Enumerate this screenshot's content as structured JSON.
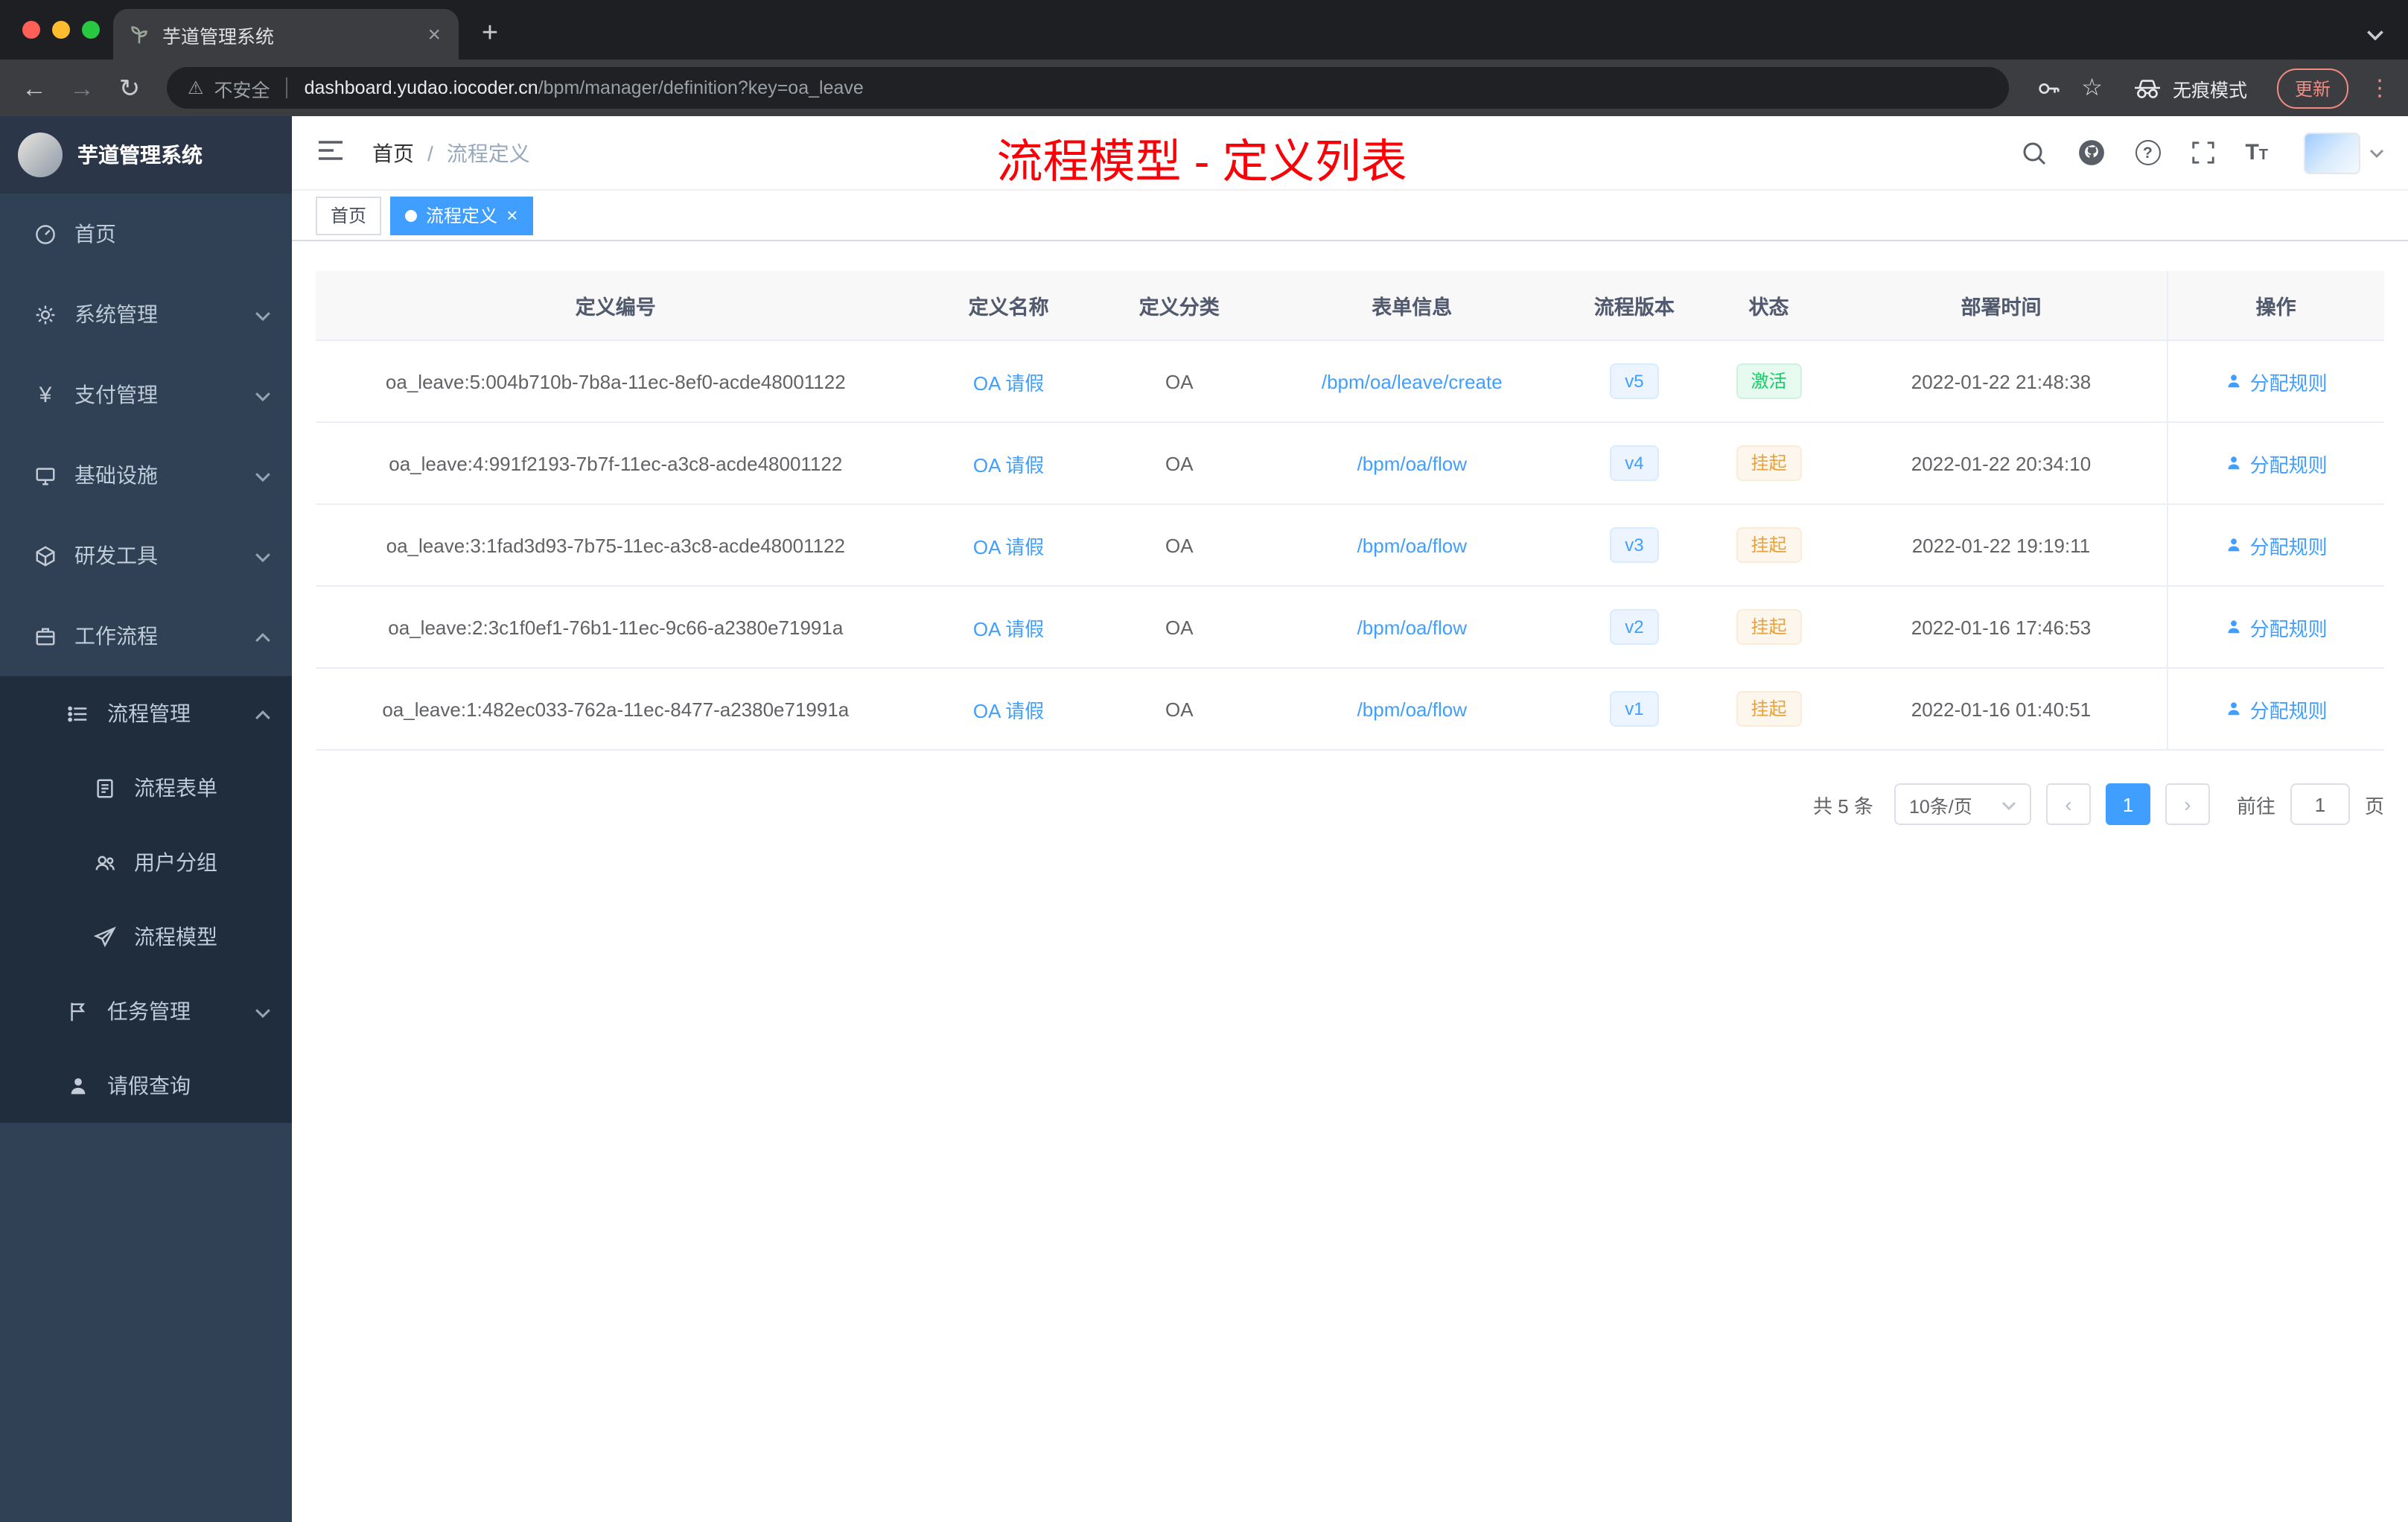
{
  "glyphs": {
    "back": "←",
    "forward": "→",
    "reload": "↻",
    "warning": "⚠",
    "star": "☆",
    "more": "⋮",
    "close": "×",
    "plus": "+",
    "question": "?",
    "font_big": "T",
    "font_small": "T",
    "yen": "¥",
    "prev": "‹",
    "next": "›"
  },
  "browser": {
    "tab_title": "芋道管理系统",
    "security_label": "不安全",
    "url_domain": "dashboard.yudao.iocoder.cn",
    "url_path": "/bpm/manager/definition?key=oa_leave",
    "incognito_label": "无痕模式",
    "update_label": "更新"
  },
  "sidebar": {
    "logo_title": "芋道管理系统",
    "items": [
      {
        "label": "首页"
      },
      {
        "label": "系统管理"
      },
      {
        "label": "支付管理"
      },
      {
        "label": "基础设施"
      },
      {
        "label": "研发工具"
      },
      {
        "label": "工作流程"
      },
      {
        "label": "流程管理"
      },
      {
        "label": "流程表单"
      },
      {
        "label": "用户分组"
      },
      {
        "label": "流程模型"
      },
      {
        "label": "任务管理"
      },
      {
        "label": "请假查询"
      }
    ]
  },
  "header": {
    "breadcrumb_home": "首页",
    "breadcrumb_sep": "/",
    "breadcrumb_current": "流程定义",
    "annotation": "流程模型 - 定义列表"
  },
  "tags": {
    "home": "首页",
    "current": "流程定义"
  },
  "table": {
    "columns": {
      "id": "定义编号",
      "name": "定义名称",
      "category": "定义分类",
      "form": "表单信息",
      "version": "流程版本",
      "status": "状态",
      "deploy_time": "部署时间",
      "actions": "操作"
    },
    "rows": [
      {
        "id": "oa_leave:5:004b710b-7b8a-11ec-8ef0-acde48001122",
        "name": "OA 请假",
        "category": "OA",
        "form": "/bpm/oa/leave/create",
        "version": "v5",
        "status": "激活",
        "deploy_time": "2022-01-22 21:48:38",
        "action": "分配规则"
      },
      {
        "id": "oa_leave:4:991f2193-7b7f-11ec-a3c8-acde48001122",
        "name": "OA 请假",
        "category": "OA",
        "form": "/bpm/oa/flow",
        "version": "v4",
        "status": "挂起",
        "deploy_time": "2022-01-22 20:34:10",
        "action": "分配规则"
      },
      {
        "id": "oa_leave:3:1fad3d93-7b75-11ec-a3c8-acde48001122",
        "name": "OA 请假",
        "category": "OA",
        "form": "/bpm/oa/flow",
        "version": "v3",
        "status": "挂起",
        "deploy_time": "2022-01-22 19:19:11",
        "action": "分配规则"
      },
      {
        "id": "oa_leave:2:3c1f0ef1-76b1-11ec-9c66-a2380e71991a",
        "name": "OA 请假",
        "category": "OA",
        "form": "/bpm/oa/flow",
        "version": "v2",
        "status": "挂起",
        "deploy_time": "2022-01-16 17:46:53",
        "action": "分配规则"
      },
      {
        "id": "oa_leave:1:482ec033-762a-11ec-8477-a2380e71991a",
        "name": "OA 请假",
        "category": "OA",
        "form": "/bpm/oa/flow",
        "version": "v1",
        "status": "挂起",
        "deploy_time": "2022-01-16 01:40:51",
        "action": "分配规则"
      }
    ]
  },
  "pagination": {
    "total": "共 5 条",
    "page_size": "10条/页",
    "page": "1",
    "goto_label": "前往",
    "goto_value": "1",
    "goto_unit": "页"
  }
}
